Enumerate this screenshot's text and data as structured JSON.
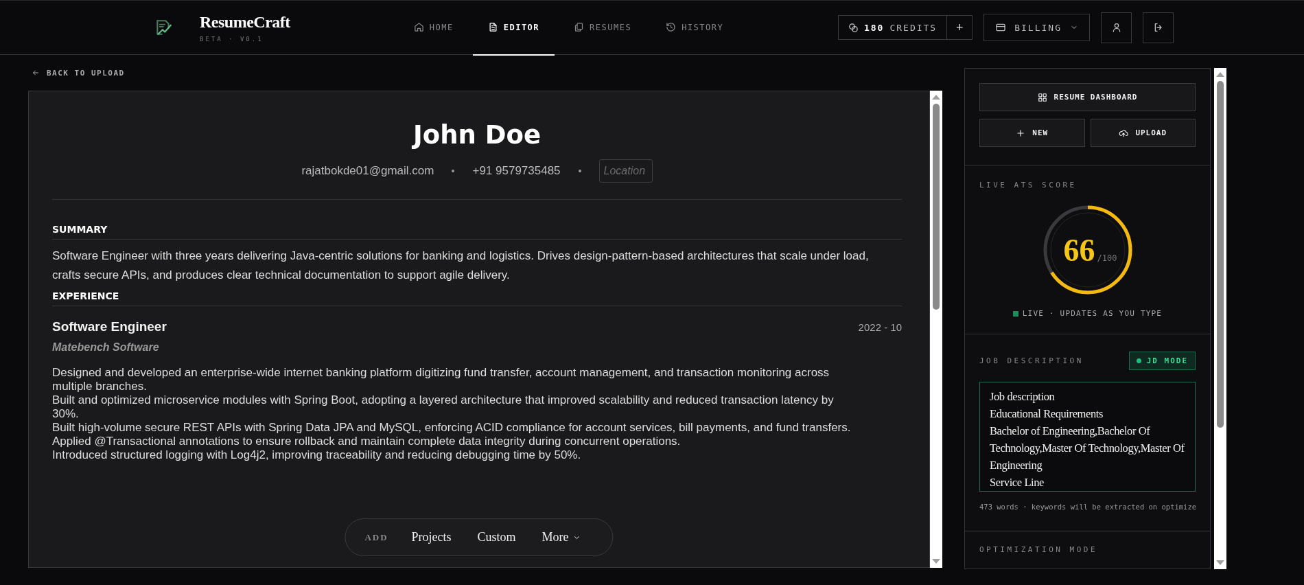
{
  "app": {
    "name": "ResumeCraft",
    "version": "BETA · V0.1"
  },
  "nav": [
    {
      "label": "HOME",
      "kind": "home",
      "selected": false
    },
    {
      "label": "EDITOR",
      "kind": "doc",
      "selected": true
    },
    {
      "label": "RESUMES",
      "kind": "copies",
      "selected": false
    },
    {
      "label": "HISTORY",
      "kind": "history",
      "selected": false
    }
  ],
  "credits": {
    "count": "180",
    "label": "CREDITS",
    "add": "+"
  },
  "billing": {
    "label": "BILLING"
  },
  "back_link": "BACK TO UPLOAD",
  "resume": {
    "name": "John Doe",
    "contacts": [
      {
        "kind": "text",
        "value": "rajatbokde01@gmail.com"
      },
      {
        "kind": "text",
        "value": "+91 9579735485"
      },
      {
        "kind": "field",
        "placeholder": "Location"
      }
    ],
    "sections": [
      {
        "kind": "paragraph",
        "heading": "SUMMARY",
        "text": "Software Engineer with three years delivering Java-centric solutions for banking and logistics. Drives design-pattern-based architectures that scale under load, crafts secure APIs, and produces clear technical documentation to support agile delivery."
      },
      {
        "kind": "jobs",
        "heading": "EXPERIENCE",
        "jobs": [
          {
            "title": "Software Engineer",
            "date": "2022 - 10",
            "company": "Matebench Software",
            "bullets": [
              "Designed and developed an enterprise-wide internet banking platform digitizing fund transfer, account management, and transaction monitoring across multiple branches.",
              "Built and optimized microservice modules with Spring Boot, adopting a layered architecture that improved scalability and reduced transaction latency by 30%.",
              "Built high-volume secure REST APIs with Spring Data JPA and MySQL, enforcing ACID compliance for account services, bill payments, and fund transfers.",
              "Applied @Transactional annotations to ensure rollback and maintain complete data integrity during concurrent operations.",
              "Introduced structured logging with Log4j2, improving traceability and reducing debugging time by 50%."
            ]
          }
        ]
      }
    ]
  },
  "add_bar": {
    "label": "ADD",
    "items": [
      {
        "kind": "plain",
        "label": "Projects"
      },
      {
        "kind": "plain",
        "label": "Custom"
      },
      {
        "kind": "menu",
        "label": "More"
      }
    ]
  },
  "sidebar": {
    "dashboard_button": "RESUME DASHBOARD",
    "buttons": [
      {
        "kind": "plus",
        "label": "NEW"
      },
      {
        "kind": "cloud",
        "label": "UPLOAD"
      }
    ],
    "ats": {
      "title": "LIVE ATS SCORE",
      "score": "66",
      "max": "/100",
      "level": 0.66,
      "status": "LIVE · UPDATES AS YOU TYPE"
    },
    "job_description": {
      "title": "JOB DESCRIPTION",
      "mode_badge": "JD MODE",
      "value": "Job description\nEducational Requirements\nBachelor of Engineering,Bachelor Of Technology,Master Of Technology,Master Of Engineering\nService Line",
      "word_count": "473 words · keywords will be extracted on optimize"
    },
    "optimization": {
      "title": "OPTIMIZATION MODE"
    }
  }
}
